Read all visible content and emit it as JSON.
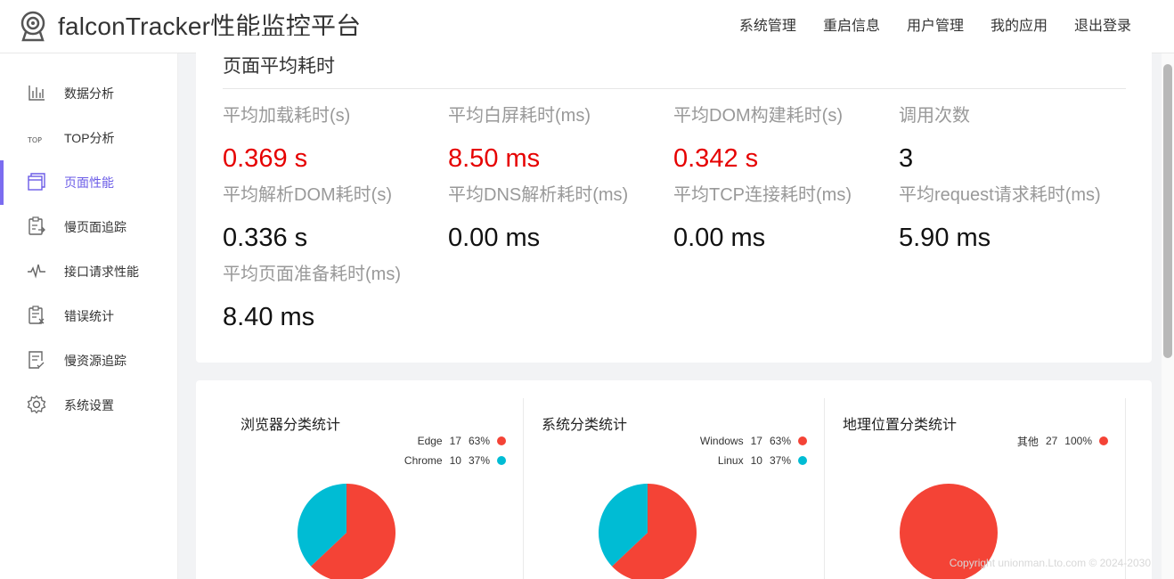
{
  "header": {
    "title": "falconTracker性能监控平台",
    "nav": [
      "系统管理",
      "重启信息",
      "用户管理",
      "我的应用",
      "退出登录"
    ]
  },
  "sidebar": {
    "items": [
      {
        "label": "数据分析",
        "icon": "bar-chart-icon"
      },
      {
        "label": "TOP分析",
        "icon": "top-icon"
      },
      {
        "label": "页面性能",
        "icon": "page-icon",
        "active": true
      },
      {
        "label": "慢页面追踪",
        "icon": "clipboard-arrow-icon"
      },
      {
        "label": "接口请求性能",
        "icon": "pulse-icon"
      },
      {
        "label": "错误统计",
        "icon": "clipboard-x-icon"
      },
      {
        "label": "慢资源追踪",
        "icon": "document-check-icon"
      },
      {
        "label": "系统设置",
        "icon": "gear-icon"
      }
    ]
  },
  "summary": {
    "title": "页面平均耗时",
    "metrics": [
      {
        "label": "平均加载耗时(s)",
        "value": "0.369 s",
        "color": "#e60000"
      },
      {
        "label": "平均白屏耗时(ms)",
        "value": "8.50 ms",
        "color": "#e60000"
      },
      {
        "label": "平均DOM构建耗时(s)",
        "value": "0.342 s",
        "color": "#e60000"
      },
      {
        "label": "调用次数",
        "value": "3",
        "color": "#111111"
      },
      {
        "label": "平均解析DOM耗时(s)",
        "value": "0.336 s",
        "color": "#111111"
      },
      {
        "label": "平均DNS解析耗时(ms)",
        "value": "0.00 ms",
        "color": "#111111"
      },
      {
        "label": "平均TCP连接耗时(ms)",
        "value": "0.00 ms",
        "color": "#111111"
      },
      {
        "label": "平均request请求耗时(ms)",
        "value": "5.90 ms",
        "color": "#111111"
      },
      {
        "label": "平均页面准备耗时(ms)",
        "value": "8.40 ms",
        "color": "#111111"
      }
    ]
  },
  "pies": [
    {
      "title": "浏览器分类统计",
      "legend": [
        {
          "name": "Edge",
          "count": "17",
          "percent": "63%",
          "color": "#f44336"
        },
        {
          "name": "Chrome",
          "count": "10",
          "percent": "37%",
          "color": "#00bcd4"
        }
      ],
      "slices": [
        17,
        10
      ]
    },
    {
      "title": "系统分类统计",
      "legend": [
        {
          "name": "Windows",
          "count": "17",
          "percent": "63%",
          "color": "#f44336"
        },
        {
          "name": "Linux",
          "count": "10",
          "percent": "37%",
          "color": "#00bcd4"
        }
      ],
      "slices": [
        17,
        10
      ]
    },
    {
      "title": "地理位置分类统计",
      "legend": [
        {
          "name": "其他",
          "count": "27",
          "percent": "100%",
          "color": "#f44336"
        }
      ],
      "slices": [
        27
      ]
    }
  ],
  "footer": {
    "copyright": "Copyright unionman.Lto.com © 2024-2030"
  }
}
